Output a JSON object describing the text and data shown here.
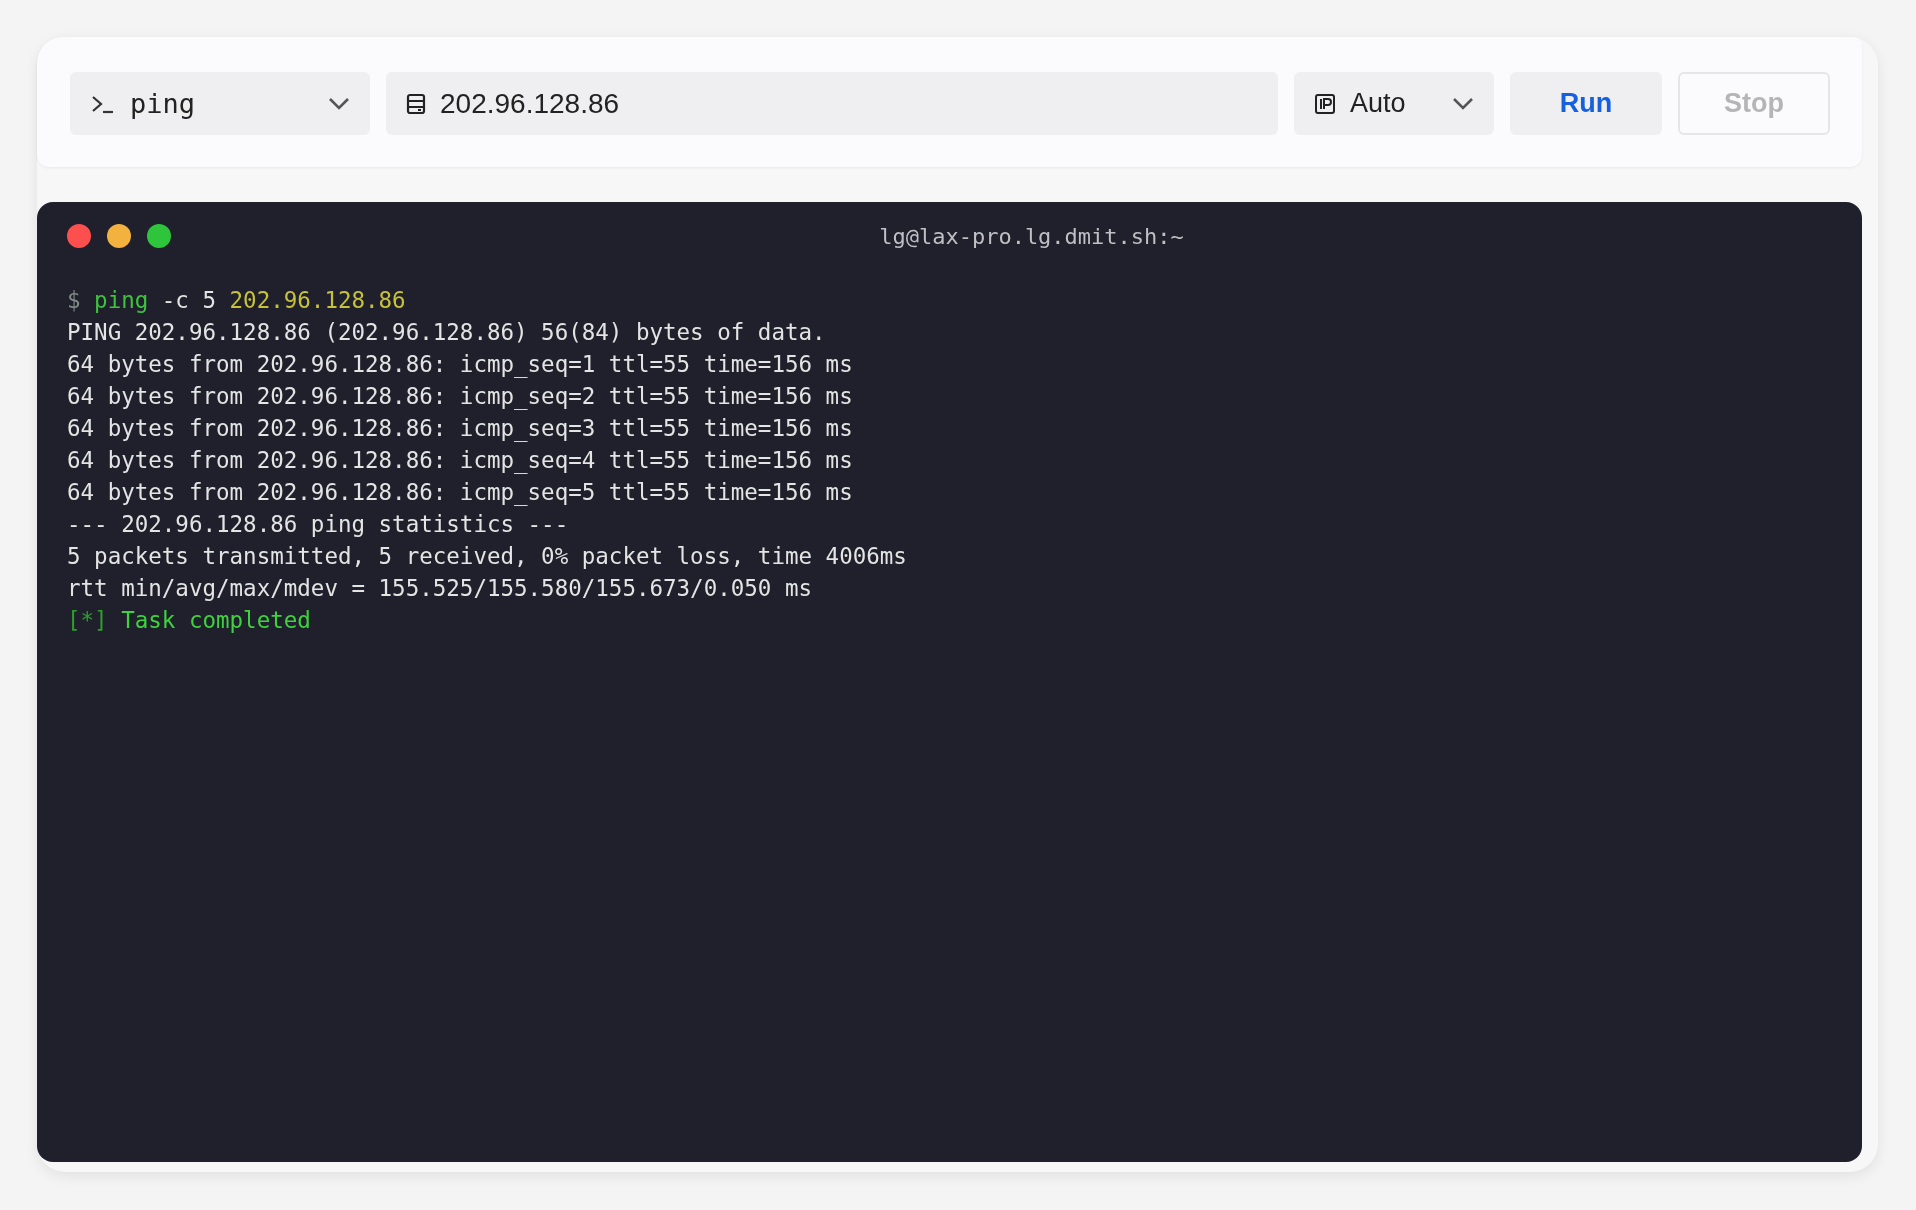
{
  "toolbar": {
    "command_select": {
      "value": "ping"
    },
    "host_field": {
      "value": "202.96.128.86"
    },
    "ip_select": {
      "value": "Auto"
    },
    "buttons": [
      {
        "label": "Run",
        "kind": "primary",
        "disabled": false
      },
      {
        "label": "Stop",
        "kind": "secondary",
        "disabled": true
      }
    ]
  },
  "terminal": {
    "title": "lg@lax-pro.lg.dmit.sh:~",
    "lines": [
      {
        "segments": [
          {
            "text": "$",
            "kind": "prompt"
          },
          {
            "text": "ping",
            "kind": "command"
          },
          {
            "text": "-c 5",
            "kind": "plain"
          },
          {
            "text": "202.96.128.86",
            "kind": "argument"
          }
        ]
      },
      {
        "segments": [
          {
            "text": "PING 202.96.128.86 (202.96.128.86) 56(84) bytes of data.",
            "kind": "plain"
          }
        ]
      },
      {
        "segments": [
          {
            "text": "64 bytes from 202.96.128.86: icmp_seq=1 ttl=55 time=156 ms",
            "kind": "plain"
          }
        ]
      },
      {
        "segments": [
          {
            "text": "64 bytes from 202.96.128.86: icmp_seq=2 ttl=55 time=156 ms",
            "kind": "plain"
          }
        ]
      },
      {
        "segments": [
          {
            "text": "64 bytes from 202.96.128.86: icmp_seq=3 ttl=55 time=156 ms",
            "kind": "plain"
          }
        ]
      },
      {
        "segments": [
          {
            "text": "64 bytes from 202.96.128.86: icmp_seq=4 ttl=55 time=156 ms",
            "kind": "plain"
          }
        ]
      },
      {
        "segments": [
          {
            "text": "64 bytes from 202.96.128.86: icmp_seq=5 ttl=55 time=156 ms",
            "kind": "plain"
          }
        ]
      },
      {
        "segments": [
          {
            "text": "--- 202.96.128.86 ping statistics ---",
            "kind": "plain"
          }
        ]
      },
      {
        "segments": [
          {
            "text": "5 packets transmitted, 5 received, 0% packet loss, time 4006ms",
            "kind": "plain"
          }
        ]
      },
      {
        "segments": [
          {
            "text": "rtt min/avg/max/mdev = 155.525/155.580/155.673/0.050 ms",
            "kind": "plain"
          }
        ]
      },
      {
        "segments": [
          {
            "text": "[*]",
            "kind": "marker"
          },
          {
            "text": "Task completed",
            "kind": "success"
          }
        ]
      }
    ]
  }
}
